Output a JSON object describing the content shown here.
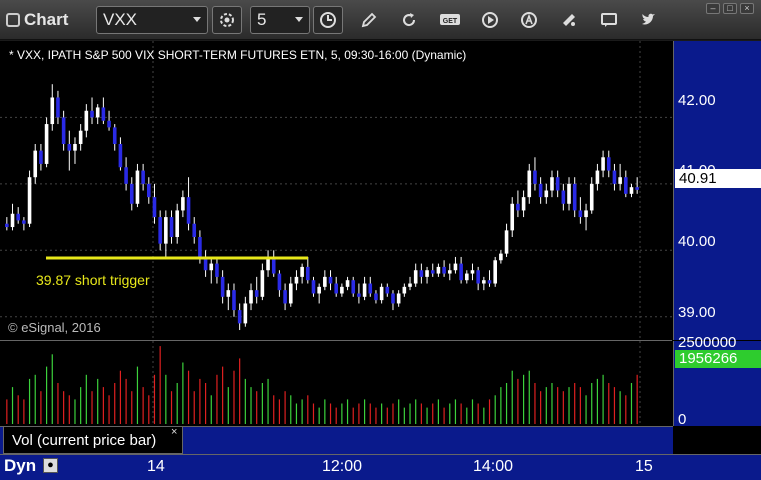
{
  "toolbar": {
    "app_title": "Chart",
    "symbol": "VXX",
    "interval": "5",
    "icons": [
      "settings-gear-icon",
      "clock-icon",
      "pencil-icon",
      "refresh-icon",
      "get-icon",
      "play-icon",
      "alert-icon",
      "tools-icon",
      "comment-icon",
      "twitter-icon"
    ],
    "get_label": "GET"
  },
  "chart": {
    "header": "* VXX, IPATH S&P 500 VIX SHORT-TERM FUTURES ETN, 5, 09:30-16:00 (Dynamic)",
    "copyright": "© eSignal, 2016",
    "annotation": "39.87 short trigger",
    "last_price": "40.91",
    "price_ticks": [
      "42.00",
      "40.00",
      "39.00"
    ],
    "price_tick_partial": "41.00",
    "last_volume": "1956266",
    "volume_ticks": [
      "2500000",
      "0"
    ],
    "time_ticks": [
      "14",
      "12:00",
      "14:00",
      "15"
    ],
    "volume_study": "Vol (current price bar)",
    "mode_label": "Dyn",
    "close_glyph": "×",
    "colors": {
      "up": "#ffffff",
      "down": "#2a2ae6",
      "trigger_line": "#e8e81a",
      "vol_up": "#3cd23c",
      "vol_down": "#e02020",
      "axis_bg": "#0a1a8c"
    }
  },
  "chart_data": {
    "type": "candlestick",
    "price_range": [
      38.65,
      43.15
    ],
    "trigger_level": 39.87,
    "candles": [
      [
        40.4,
        40.5,
        40.3,
        40.35
      ],
      [
        40.35,
        40.7,
        40.3,
        40.55
      ],
      [
        40.55,
        40.65,
        40.4,
        40.45
      ],
      [
        40.45,
        40.5,
        40.3,
        40.4
      ],
      [
        40.4,
        41.2,
        40.35,
        41.1
      ],
      [
        41.1,
        41.6,
        41.0,
        41.5
      ],
      [
        41.5,
        41.6,
        41.2,
        41.3
      ],
      [
        41.3,
        42.0,
        41.25,
        41.9
      ],
      [
        41.9,
        42.5,
        41.8,
        42.3
      ],
      [
        42.3,
        42.4,
        41.9,
        42.0
      ],
      [
        42.0,
        42.1,
        41.5,
        41.6
      ],
      [
        41.6,
        41.8,
        41.2,
        41.5
      ],
      [
        41.5,
        41.7,
        41.3,
        41.6
      ],
      [
        41.6,
        41.9,
        41.5,
        41.8
      ],
      [
        41.8,
        42.2,
        41.7,
        42.1
      ],
      [
        42.1,
        42.3,
        41.9,
        42.0
      ],
      [
        42.0,
        42.2,
        41.9,
        42.15
      ],
      [
        42.15,
        42.3,
        41.9,
        41.95
      ],
      [
        41.95,
        42.1,
        41.8,
        41.85
      ],
      [
        41.85,
        41.9,
        41.5,
        41.6
      ],
      [
        41.6,
        41.7,
        41.2,
        41.25
      ],
      [
        41.25,
        41.4,
        40.9,
        41.0
      ],
      [
        41.0,
        41.1,
        40.6,
        40.7
      ],
      [
        40.7,
        41.3,
        40.65,
        41.2
      ],
      [
        41.2,
        41.3,
        40.9,
        41.0
      ],
      [
        41.0,
        41.1,
        40.7,
        40.8
      ],
      [
        40.8,
        41.0,
        40.4,
        40.5
      ],
      [
        40.5,
        40.6,
        40.0,
        40.1
      ],
      [
        40.1,
        40.6,
        39.9,
        40.5
      ],
      [
        40.5,
        40.6,
        40.1,
        40.2
      ],
      [
        40.2,
        40.7,
        40.1,
        40.6
      ],
      [
        40.6,
        40.9,
        40.5,
        40.8
      ],
      [
        40.8,
        41.1,
        40.3,
        40.4
      ],
      [
        40.4,
        40.5,
        40.1,
        40.2
      ],
      [
        40.2,
        40.3,
        39.8,
        39.9
      ],
      [
        39.9,
        40.0,
        39.6,
        39.7
      ],
      [
        39.7,
        39.9,
        39.5,
        39.8
      ],
      [
        39.8,
        39.9,
        39.5,
        39.6
      ],
      [
        39.6,
        39.7,
        39.2,
        39.3
      ],
      [
        39.3,
        39.5,
        39.1,
        39.4
      ],
      [
        39.4,
        39.5,
        39.0,
        39.1
      ],
      [
        39.1,
        39.2,
        38.8,
        38.9
      ],
      [
        38.9,
        39.3,
        38.85,
        39.2
      ],
      [
        39.2,
        39.5,
        39.1,
        39.4
      ],
      [
        39.4,
        39.6,
        39.2,
        39.3
      ],
      [
        39.3,
        39.8,
        39.25,
        39.7
      ],
      [
        39.7,
        40.0,
        39.6,
        39.9
      ],
      [
        39.9,
        40.0,
        39.6,
        39.65
      ],
      [
        39.65,
        39.7,
        39.3,
        39.4
      ],
      [
        39.4,
        39.5,
        39.1,
        39.2
      ],
      [
        39.2,
        39.6,
        39.15,
        39.5
      ],
      [
        39.5,
        39.7,
        39.4,
        39.6
      ],
      [
        39.6,
        39.8,
        39.5,
        39.75
      ],
      [
        39.75,
        39.9,
        39.5,
        39.55
      ],
      [
        39.55,
        39.6,
        39.3,
        39.35
      ],
      [
        39.35,
        39.5,
        39.2,
        39.45
      ],
      [
        39.45,
        39.7,
        39.4,
        39.6
      ],
      [
        39.6,
        39.7,
        39.4,
        39.5
      ],
      [
        39.5,
        39.6,
        39.3,
        39.35
      ],
      [
        39.35,
        39.5,
        39.3,
        39.45
      ],
      [
        39.45,
        39.6,
        39.4,
        39.55
      ],
      [
        39.55,
        39.6,
        39.3,
        39.35
      ],
      [
        39.35,
        39.5,
        39.2,
        39.3
      ],
      [
        39.3,
        39.6,
        39.25,
        39.5
      ],
      [
        39.5,
        39.6,
        39.3,
        39.35
      ],
      [
        39.35,
        39.4,
        39.2,
        39.25
      ],
      [
        39.25,
        39.5,
        39.2,
        39.45
      ],
      [
        39.45,
        39.5,
        39.3,
        39.35
      ],
      [
        39.35,
        39.4,
        39.1,
        39.2
      ],
      [
        39.2,
        39.4,
        39.15,
        39.35
      ],
      [
        39.35,
        39.5,
        39.3,
        39.45
      ],
      [
        39.45,
        39.6,
        39.4,
        39.5
      ],
      [
        39.5,
        39.8,
        39.45,
        39.7
      ],
      [
        39.7,
        39.8,
        39.5,
        39.6
      ],
      [
        39.6,
        39.75,
        39.5,
        39.7
      ],
      [
        39.7,
        39.8,
        39.6,
        39.65
      ],
      [
        39.65,
        39.8,
        39.6,
        39.75
      ],
      [
        39.75,
        39.85,
        39.6,
        39.65
      ],
      [
        39.65,
        39.8,
        39.55,
        39.7
      ],
      [
        39.7,
        39.9,
        39.65,
        39.8
      ],
      [
        39.8,
        39.9,
        39.5,
        39.55
      ],
      [
        39.55,
        39.7,
        39.5,
        39.65
      ],
      [
        39.65,
        39.8,
        39.55,
        39.7
      ],
      [
        39.7,
        39.75,
        39.4,
        39.5
      ],
      [
        39.5,
        39.6,
        39.4,
        39.55
      ],
      [
        39.55,
        39.7,
        39.45,
        39.5
      ],
      [
        39.5,
        39.9,
        39.45,
        39.85
      ],
      [
        39.85,
        40.0,
        39.8,
        39.95
      ],
      [
        39.95,
        40.4,
        39.9,
        40.3
      ],
      [
        40.3,
        40.8,
        40.2,
        40.7
      ],
      [
        40.7,
        40.9,
        40.5,
        40.6
      ],
      [
        40.6,
        40.9,
        40.5,
        40.8
      ],
      [
        40.8,
        41.3,
        40.7,
        41.2
      ],
      [
        41.2,
        41.4,
        40.9,
        41.0
      ],
      [
        41.0,
        41.1,
        40.7,
        40.8
      ],
      [
        40.8,
        41.0,
        40.7,
        40.9
      ],
      [
        40.9,
        41.2,
        40.8,
        41.1
      ],
      [
        41.1,
        41.2,
        40.8,
        40.9
      ],
      [
        40.9,
        41.0,
        40.6,
        40.7
      ],
      [
        40.7,
        41.1,
        40.6,
        41.0
      ],
      [
        41.0,
        41.1,
        40.5,
        40.6
      ],
      [
        40.6,
        40.8,
        40.4,
        40.5
      ],
      [
        40.5,
        40.7,
        40.3,
        40.6
      ],
      [
        40.6,
        41.1,
        40.55,
        41.0
      ],
      [
        41.0,
        41.3,
        40.9,
        41.2
      ],
      [
        41.2,
        41.5,
        41.1,
        41.4
      ],
      [
        41.4,
        41.5,
        41.1,
        41.2
      ],
      [
        41.2,
        41.3,
        40.9,
        41.0
      ],
      [
        41.0,
        41.3,
        40.9,
        41.1
      ],
      [
        41.1,
        41.2,
        40.8,
        40.85
      ],
      [
        40.85,
        41.0,
        40.8,
        40.95
      ],
      [
        40.95,
        41.1,
        40.85,
        40.91
      ]
    ],
    "volumes": [
      0.3,
      0.45,
      0.35,
      0.3,
      0.55,
      0.6,
      0.4,
      0.7,
      0.85,
      0.5,
      0.4,
      0.35,
      0.3,
      0.45,
      0.6,
      0.4,
      0.55,
      0.45,
      0.35,
      0.5,
      0.65,
      0.55,
      0.4,
      0.7,
      0.45,
      0.35,
      0.6,
      0.95,
      0.6,
      0.4,
      0.5,
      0.75,
      0.65,
      0.4,
      0.55,
      0.5,
      0.35,
      0.6,
      0.7,
      0.45,
      0.65,
      0.8,
      0.55,
      0.45,
      0.4,
      0.5,
      0.55,
      0.35,
      0.3,
      0.4,
      0.35,
      0.25,
      0.3,
      0.35,
      0.25,
      0.2,
      0.3,
      0.25,
      0.2,
      0.25,
      0.3,
      0.2,
      0.25,
      0.3,
      0.25,
      0.2,
      0.25,
      0.2,
      0.25,
      0.3,
      0.2,
      0.25,
      0.3,
      0.25,
      0.2,
      0.25,
      0.3,
      0.2,
      0.25,
      0.3,
      0.25,
      0.2,
      0.3,
      0.25,
      0.2,
      0.3,
      0.35,
      0.45,
      0.5,
      0.65,
      0.55,
      0.6,
      0.65,
      0.5,
      0.4,
      0.45,
      0.5,
      0.45,
      0.4,
      0.45,
      0.5,
      0.45,
      0.35,
      0.5,
      0.55,
      0.6,
      0.5,
      0.45,
      0.4,
      0.35,
      0.5,
      0.6
    ],
    "volume_max": 2500000
  }
}
